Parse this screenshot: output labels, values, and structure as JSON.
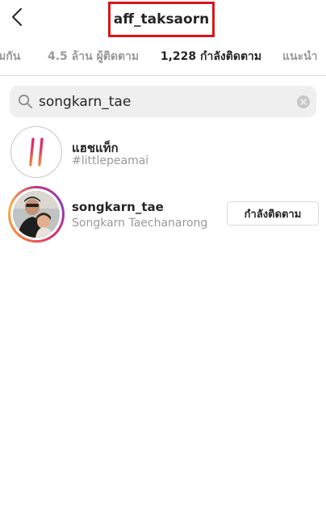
{
  "header": {
    "title": "aff_taksaorn",
    "back_icon": "chevron-left-icon"
  },
  "tabs": [
    {
      "label": "มกัน",
      "active": false
    },
    {
      "label": "4.5 ล้าน ผู้ติดตาม",
      "active": false
    },
    {
      "label": "1,228 กำลังติดตาม",
      "active": true
    },
    {
      "label": "แนะนำ",
      "active": false
    }
  ],
  "search": {
    "value": "songkarn_tae",
    "search_icon": "search-icon",
    "clear_icon": "clear-icon"
  },
  "results": [
    {
      "type": "hashtag",
      "title": "แฮชแท็ก",
      "subtitle": "#littlepeamai",
      "icon": "hashtag-icon"
    },
    {
      "type": "user",
      "username": "songkarn_tae",
      "full_name": "Songkarn Taechanarong",
      "button_label": "กำลังติดตาม"
    }
  ],
  "colors": {
    "highlight_box": "#d8161b",
    "text_primary": "#262626",
    "text_secondary": "#999999",
    "search_bg": "#efefef"
  }
}
